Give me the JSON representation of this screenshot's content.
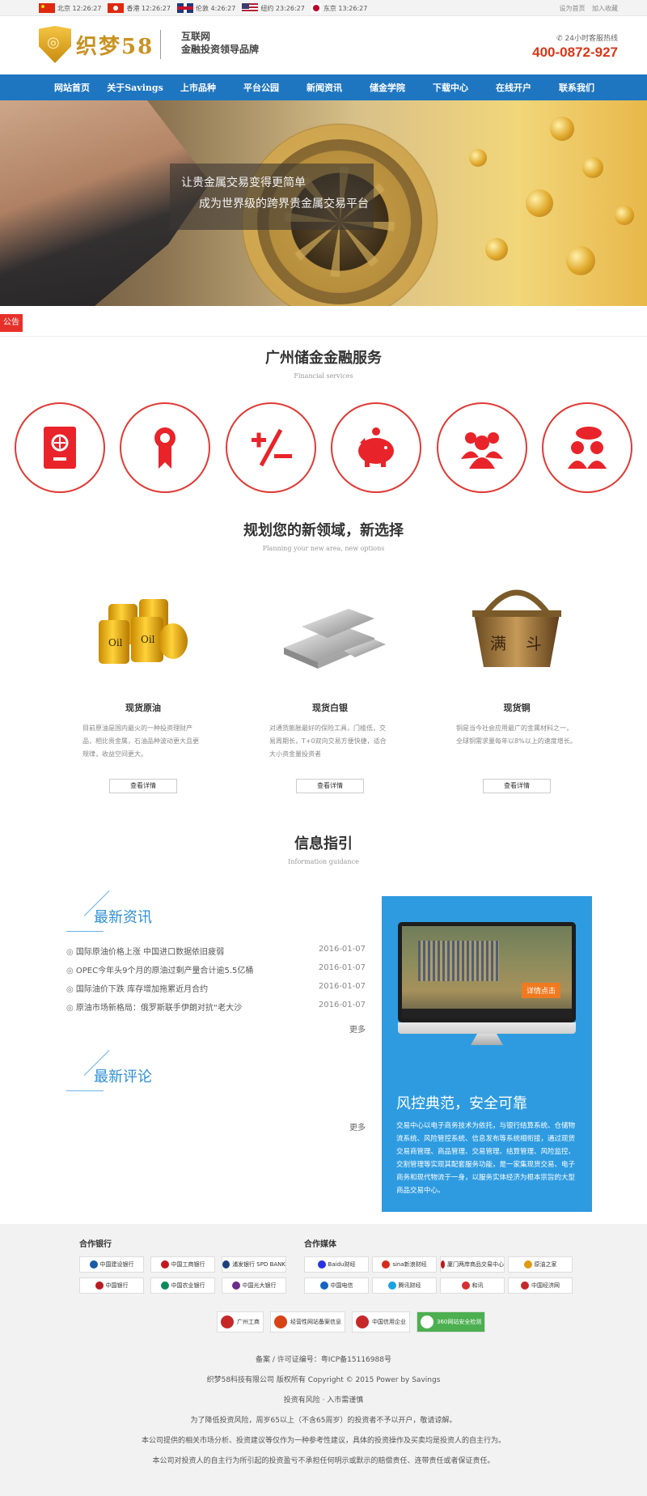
{
  "topbar": {
    "clocks": [
      {
        "city": "北京",
        "time": "12:26:27"
      },
      {
        "city": "香港",
        "time": "12:26:27"
      },
      {
        "city": "伦敦",
        "time": "4:26:27"
      },
      {
        "city": "纽约",
        "time": "23:26:27"
      },
      {
        "city": "东京",
        "time": "13:26:27"
      }
    ],
    "set_home": "设为首页",
    "add_favorite": "加入收藏"
  },
  "header": {
    "logo_text": "织梦58",
    "slogan_line1": "互联网",
    "slogan_line2": "金融投资领导品牌",
    "hotline_label": "24小时客服热线",
    "hotline_number": "400-0872-927"
  },
  "nav": [
    "网站首页",
    "关于Savings",
    "上市品种",
    "平台公园",
    "新闻资讯",
    "储金学院",
    "下载中心",
    "在线开户",
    "联系我们"
  ],
  "banner": {
    "line1": "让贵金属交易变得更简单",
    "line2": "成为世界级的跨界贵金属交易平台"
  },
  "notice": {
    "tag": "公告"
  },
  "services": {
    "title": "广州储金金融服务",
    "subtitle": "Financial services",
    "icons": [
      "safe-icon",
      "award-ribbon-icon",
      "plus-minus-icon",
      "piggy-bank-icon",
      "team-icon",
      "customer-service-icon"
    ]
  },
  "planning": {
    "title": "规划您的新领域，新选择",
    "subtitle": "Planning your new area, new options",
    "products": [
      {
        "name": "现货原油",
        "desc": "目前原油是国内最火的一种投资理财产品，相比贵金属，石油品种波动更大且更规律，收益空间更大。",
        "button": "查看详情"
      },
      {
        "name": "现货白银",
        "desc": "对通货膨胀最好的保险工具，门槛低，交易周期长，T+0双向交易方便快捷，适合大小资金量投资者",
        "button": "查看详情"
      },
      {
        "name": "现货铜",
        "desc": "铜是当今社会应用最广的金属材料之一，全球铜需求量每年以8%以上的速度增长。",
        "button": "查看详情"
      }
    ]
  },
  "info": {
    "title": "信息指引",
    "subtitle": "Information guidance",
    "news_title": "最新资讯",
    "news": [
      {
        "title": "国际原油价格上涨 中国进口数据依旧疲弱",
        "date": "2016-01-07"
      },
      {
        "title": "OPEC今年头9个月的原油过剩产量合计逾5.5亿桶",
        "date": "2016-01-07"
      },
      {
        "title": "国际油价下跌 库存增加拖累近月合约",
        "date": "2016-01-07"
      },
      {
        "title": "原油市场新格局：俄罗斯联手伊朗对抗“老大沙",
        "date": "2016-01-07"
      }
    ],
    "news_more": "更多",
    "comments_title": "最新评论",
    "comments_more": "更多",
    "promo_button": "详情点击",
    "promo_title": "风控典范，安全可靠",
    "promo_text": "交易中心以电子商务技术为依托，与银行结算系统、仓储物流系统、风险管控系统、信息发布等系统相衔接，通过现货交易商管理、商品管理、交易管理、结算管理、风险监控、交割管理等实现其配套服务功能，是一家集现货交易、电子商务和现代物流于一身，以服务实体经济为根本宗旨的大型商品交易中心。"
  },
  "footer": {
    "banks_title": "合作银行",
    "media_title": "合作媒体",
    "banks": [
      {
        "name": "中国建设银行",
        "color": "#1a5aa6"
      },
      {
        "name": "中国工商银行",
        "color": "#c8161d"
      },
      {
        "name": "浦发银行 SPD BANK",
        "color": "#1a3f7a"
      },
      {
        "name": "中国银行",
        "color": "#b81c22"
      },
      {
        "name": "中国农业银行",
        "color": "#0a8a5a"
      },
      {
        "name": "中国光大银行",
        "color": "#6b2c8a"
      }
    ],
    "media": [
      {
        "name": "Baidu财经",
        "color": "#2932e1"
      },
      {
        "name": "sina新浪财经",
        "color": "#d52b1e"
      },
      {
        "name": "厦门两岸商品交易中心",
        "color": "#b71c1c"
      },
      {
        "name": "原油之家",
        "color": "#e09a10"
      },
      {
        "name": "中国电信",
        "color": "#1565c0"
      },
      {
        "name": "腾讯财经",
        "color": "#1aa3e0"
      },
      {
        "name": "和讯",
        "color": "#d32f2f"
      },
      {
        "name": "中国经济网",
        "color": "#c62828"
      }
    ],
    "badges": [
      {
        "name": "广州工商",
        "color": "#c62828"
      },
      {
        "name": "经营性网站备案信息",
        "color": "#d84315"
      },
      {
        "name": "中国信用企业",
        "color": "#c62828"
      },
      {
        "name": "360网站安全检测",
        "color": "#43a047"
      }
    ],
    "icp": "备案 / 许可证编号：粤ICP备15116988号",
    "copyright": "织梦58科技有限公司 版权所有 Copyright © 2015 Power by Savings",
    "risk": "投资有风险 · 入市需谨慎",
    "notice1": "为了降低投资风险，周岁65以上（不含65周岁）的投资者不予以开户，敬请谅解。",
    "notice2": "本公司提供的相关市场分析、投资建议等仅作为一种参考性建议，具体的投资操作及买卖均是投资人的自主行为。",
    "notice3": "本公司对投资人的自主行为所引起的投资盈亏不承担任何明示或默示的赔偿责任、连带责任或者保证责任。"
  }
}
